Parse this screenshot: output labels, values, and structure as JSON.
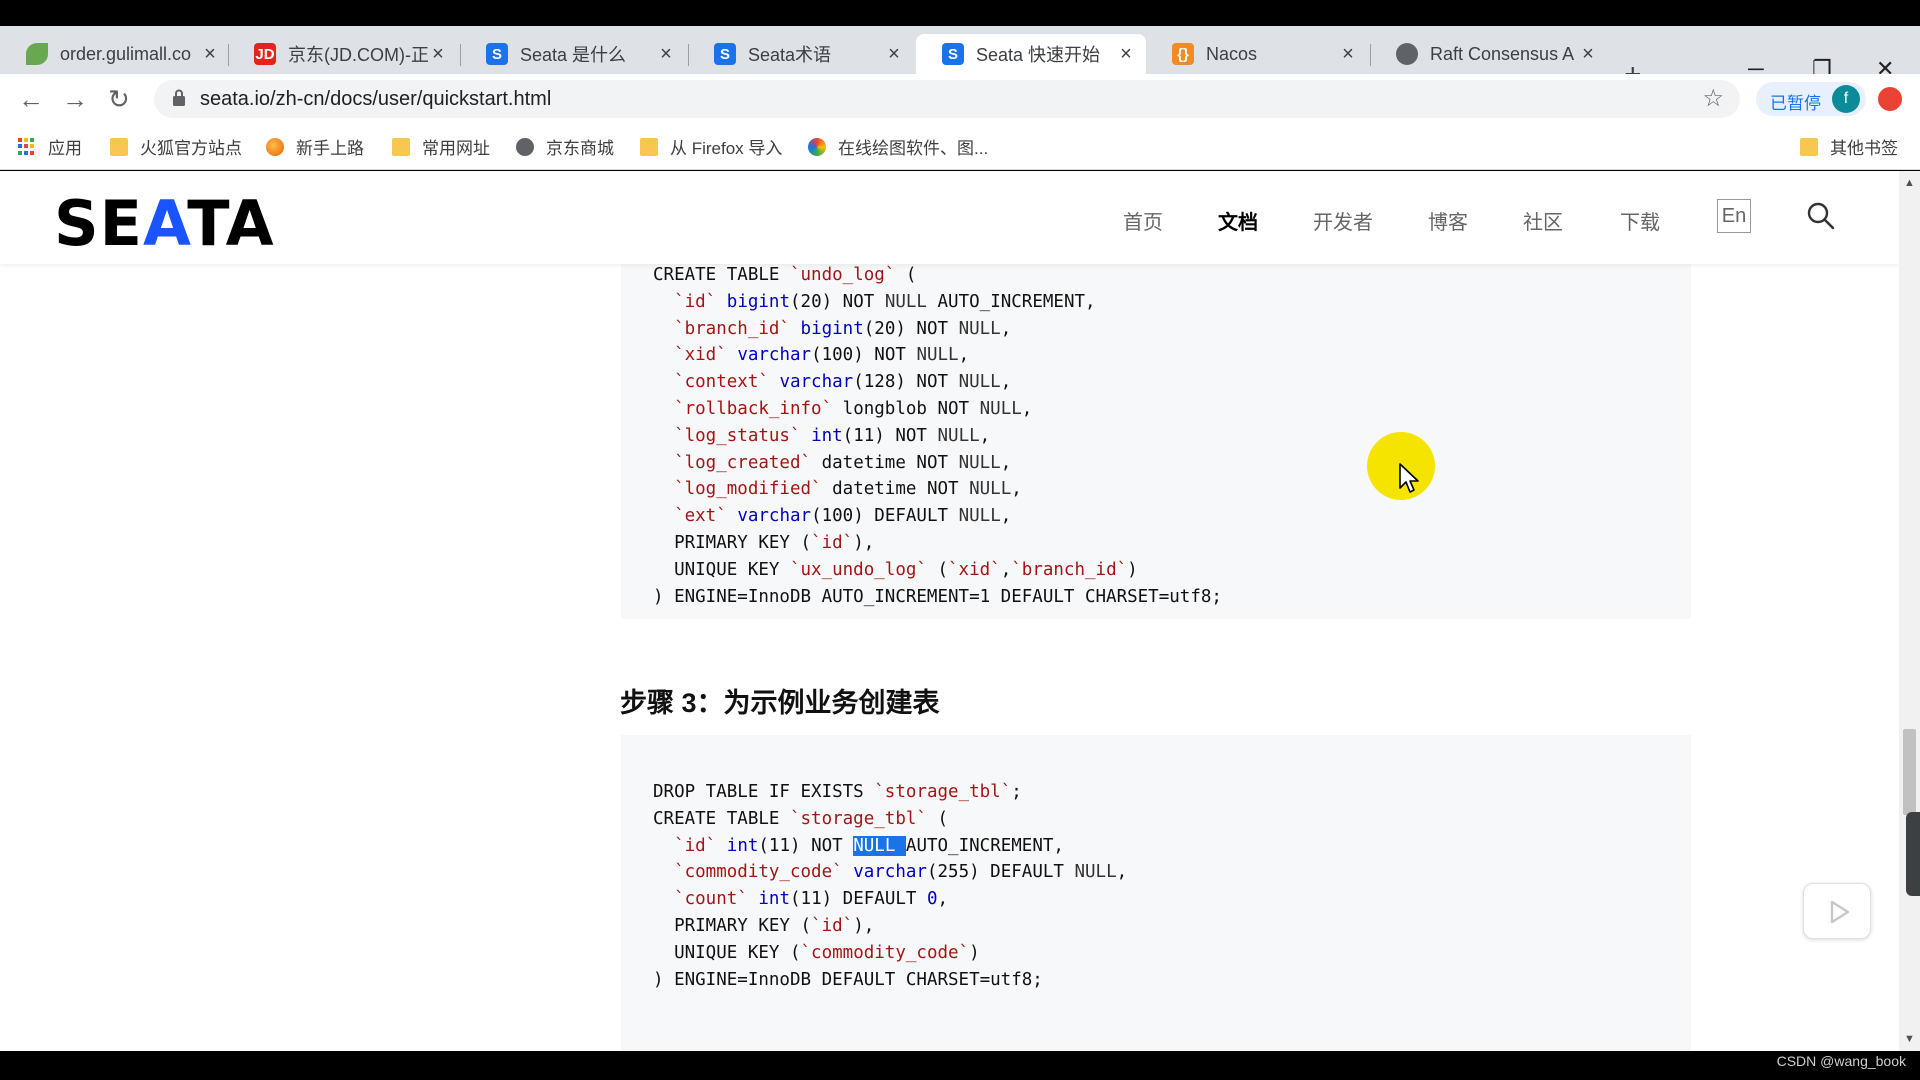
{
  "tabs": [
    {
      "title": "order.gulimall.co",
      "favicon": "leaf-icon",
      "color": "#6aa84f",
      "active": false
    },
    {
      "title": "京东(JD.COM)-正",
      "favicon": "jd-icon",
      "color": "#e1251b",
      "active": false,
      "glyph": "JD"
    },
    {
      "title": "Seata 是什么",
      "favicon": "seata-icon",
      "color": "#1a73e8",
      "active": false,
      "glyph": "S"
    },
    {
      "title": "Seata术语",
      "favicon": "seata-icon",
      "color": "#1a73e8",
      "active": false,
      "glyph": "S"
    },
    {
      "title": "Seata 快速开始",
      "favicon": "seata-icon",
      "color": "#1a73e8",
      "active": true,
      "glyph": "S"
    },
    {
      "title": "Nacos",
      "favicon": "nacos-icon",
      "color": "#f28b25",
      "active": false,
      "glyph": "{}"
    },
    {
      "title": "Raft Consensus A",
      "favicon": "globe-icon",
      "color": "#5f6368",
      "active": false
    }
  ],
  "tab_close_glyph": "×",
  "new_tab_glyph": "+",
  "window_controls": {
    "minimize": "─",
    "restore": "❐",
    "close": "✕"
  },
  "toolbar": {
    "back_glyph": "←",
    "forward_glyph": "→",
    "reload_glyph": "↻",
    "url": "seata.io/zh-cn/docs/user/quickstart.html",
    "star_glyph": "☆",
    "paused_label": "已暂停",
    "profile_initial": "f"
  },
  "bookmarks": [
    {
      "label": "应用",
      "icon": "apps-icon"
    },
    {
      "label": "火狐官方站点",
      "icon": "folder-icon"
    },
    {
      "label": "新手上路",
      "icon": "firefox-icon"
    },
    {
      "label": "常用网址",
      "icon": "folder-icon"
    },
    {
      "label": "京东商城",
      "icon": "globe-icon"
    },
    {
      "label": "从 Firefox 导入",
      "icon": "folder-icon"
    },
    {
      "label": "在线绘图软件、图...",
      "icon": "drawio-icon"
    },
    {
      "label": "其他书签",
      "icon": "folder-icon"
    }
  ],
  "site": {
    "logo": "SEATA",
    "nav": [
      "首页",
      "文档",
      "开发者",
      "博客",
      "社区",
      "下载"
    ],
    "active_nav": "文档",
    "lang_label": "En"
  },
  "code_block_1": [
    [
      {
        "t": "CREATE TABLE "
      },
      {
        "t": "`undo_log`",
        "c": "str"
      },
      {
        "t": " ("
      }
    ],
    [
      {
        "t": "  "
      },
      {
        "t": "`id`",
        "c": "str"
      },
      {
        "t": " "
      },
      {
        "t": "bigint",
        "c": "type"
      },
      {
        "t": "(20) NOT "
      },
      {
        "t": "NULL",
        "c": "null"
      },
      {
        "t": " AUTO_INCREMENT,"
      }
    ],
    [
      {
        "t": "  "
      },
      {
        "t": "`branch_id`",
        "c": "str"
      },
      {
        "t": " "
      },
      {
        "t": "bigint",
        "c": "type"
      },
      {
        "t": "(20) NOT "
      },
      {
        "t": "NULL",
        "c": "null"
      },
      {
        "t": ","
      }
    ],
    [
      {
        "t": "  "
      },
      {
        "t": "`xid`",
        "c": "str"
      },
      {
        "t": " "
      },
      {
        "t": "varchar",
        "c": "type"
      },
      {
        "t": "(100) NOT "
      },
      {
        "t": "NULL",
        "c": "null"
      },
      {
        "t": ","
      }
    ],
    [
      {
        "t": "  "
      },
      {
        "t": "`context`",
        "c": "str"
      },
      {
        "t": " "
      },
      {
        "t": "varchar",
        "c": "type"
      },
      {
        "t": "(128) NOT "
      },
      {
        "t": "NULL",
        "c": "null"
      },
      {
        "t": ","
      }
    ],
    [
      {
        "t": "  "
      },
      {
        "t": "`rollback_info`",
        "c": "str"
      },
      {
        "t": " longblob NOT "
      },
      {
        "t": "NULL",
        "c": "null"
      },
      {
        "t": ","
      }
    ],
    [
      {
        "t": "  "
      },
      {
        "t": "`log_status`",
        "c": "str"
      },
      {
        "t": " "
      },
      {
        "t": "int",
        "c": "type"
      },
      {
        "t": "(11) NOT "
      },
      {
        "t": "NULL",
        "c": "null"
      },
      {
        "t": ","
      }
    ],
    [
      {
        "t": "  "
      },
      {
        "t": "`log_created`",
        "c": "str"
      },
      {
        "t": " datetime NOT "
      },
      {
        "t": "NULL",
        "c": "null"
      },
      {
        "t": ","
      }
    ],
    [
      {
        "t": "  "
      },
      {
        "t": "`log_modified`",
        "c": "str"
      },
      {
        "t": " datetime NOT "
      },
      {
        "t": "NULL",
        "c": "null"
      },
      {
        "t": ","
      }
    ],
    [
      {
        "t": "  "
      },
      {
        "t": "`ext`",
        "c": "str"
      },
      {
        "t": " "
      },
      {
        "t": "varchar",
        "c": "type"
      },
      {
        "t": "(100) DEFAULT "
      },
      {
        "t": "NULL",
        "c": "null"
      },
      {
        "t": ","
      }
    ],
    [
      {
        "t": "  PRIMARY KEY ("
      },
      {
        "t": "`id`",
        "c": "str"
      },
      {
        "t": "),"
      }
    ],
    [
      {
        "t": "  UNIQUE KEY "
      },
      {
        "t": "`ux_undo_log`",
        "c": "str"
      },
      {
        "t": " ("
      },
      {
        "t": "`xid`",
        "c": "str"
      },
      {
        "t": ","
      },
      {
        "t": "`branch_id`",
        "c": "str"
      },
      {
        "t": ")"
      }
    ],
    [
      {
        "t": ") ENGINE=InnoDB AUTO_INCREMENT=1 DEFAULT CHARSET=utf8;"
      }
    ]
  ],
  "step_heading": "步骤 3：为示例业务创建表",
  "code_block_2": [
    [
      {
        "t": "DROP TABLE IF EXISTS "
      },
      {
        "t": "`storage_tbl`",
        "c": "str"
      },
      {
        "t": ";"
      }
    ],
    [
      {
        "t": "CREATE TABLE "
      },
      {
        "t": "`storage_tbl`",
        "c": "str"
      },
      {
        "t": " ("
      }
    ],
    [
      {
        "t": "  "
      },
      {
        "t": "`id`",
        "c": "str"
      },
      {
        "t": " "
      },
      {
        "t": "int",
        "c": "type"
      },
      {
        "t": "(11) NOT "
      },
      {
        "t": "NULL ",
        "c": "sel"
      },
      {
        "t": "AUTO_INCREMENT,"
      }
    ],
    [
      {
        "t": "  "
      },
      {
        "t": "`commodity_code`",
        "c": "str"
      },
      {
        "t": " "
      },
      {
        "t": "varchar",
        "c": "type"
      },
      {
        "t": "(255) DEFAULT "
      },
      {
        "t": "NULL",
        "c": "null"
      },
      {
        "t": ","
      }
    ],
    [
      {
        "t": "  "
      },
      {
        "t": "`count`",
        "c": "str"
      },
      {
        "t": " "
      },
      {
        "t": "int",
        "c": "type"
      },
      {
        "t": "(11) DEFAULT "
      },
      {
        "t": "0",
        "c": "type"
      },
      {
        "t": ","
      }
    ],
    [
      {
        "t": "  PRIMARY KEY ("
      },
      {
        "t": "`id`",
        "c": "str"
      },
      {
        "t": "),"
      }
    ],
    [
      {
        "t": "  UNIQUE KEY ("
      },
      {
        "t": "`commodity_code`",
        "c": "str"
      },
      {
        "t": ")"
      }
    ],
    [
      {
        "t": ") ENGINE=InnoDB DEFAULT CHARSET=utf8;"
      }
    ]
  ],
  "scroll": {
    "up_glyph": "▲",
    "down_glyph": "▼"
  },
  "watermark": "CSDN @wang_book"
}
